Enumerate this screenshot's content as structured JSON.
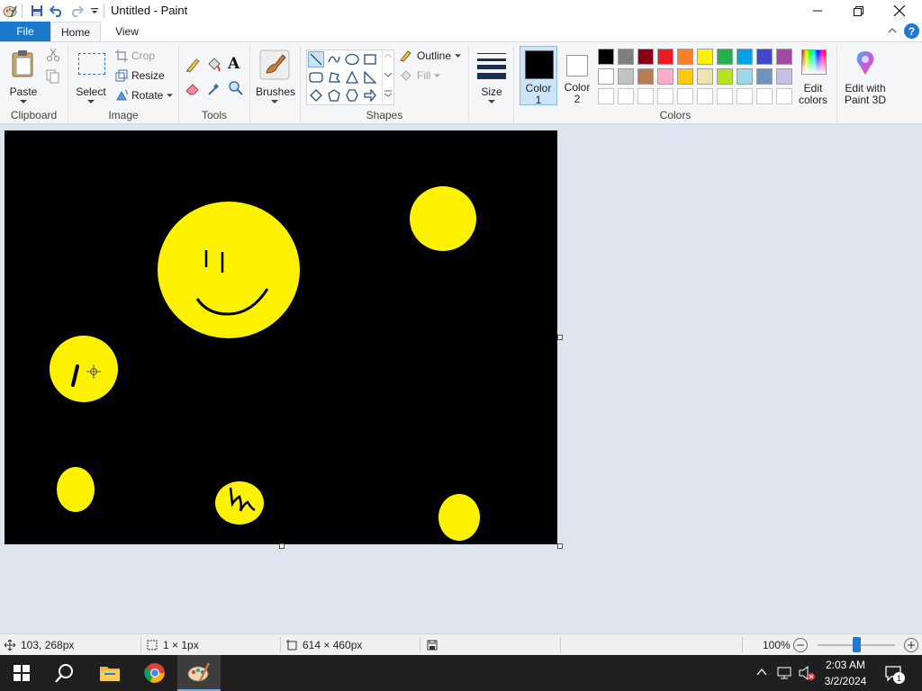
{
  "window": {
    "title": "Untitled - Paint"
  },
  "menu": {
    "file": "File",
    "home": "Home",
    "view": "View"
  },
  "clipboard": {
    "paste": "Paste",
    "group": "Clipboard"
  },
  "image": {
    "select": "Select",
    "crop": "Crop",
    "resize": "Resize",
    "rotate": "Rotate",
    "group": "Image"
  },
  "tools": {
    "group": "Tools"
  },
  "brushes": {
    "label": "Brushes"
  },
  "shapes": {
    "outline": "Outline",
    "fill": "Fill",
    "group": "Shapes"
  },
  "size": {
    "label": "Size"
  },
  "colors": {
    "color1": "Color",
    "color1_num": "1",
    "color2": "Color",
    "color2_num": "2",
    "edit": "Edit",
    "edit2": "colors",
    "paint3d": "Edit with",
    "paint3d2": "Paint 3D",
    "group": "Colors",
    "color1_value": "#000000",
    "color2_value": "#ffffff",
    "palette_row1": [
      "#000000",
      "#7f7f7f",
      "#880015",
      "#ed1c24",
      "#ff7f27",
      "#fff200",
      "#22b14c",
      "#00a2e8",
      "#3f48cc",
      "#a349a4"
    ],
    "palette_row2": [
      "#ffffff",
      "#c3c3c3",
      "#b97a57",
      "#ffaec9",
      "#ffc90e",
      "#efe4b0",
      "#b5e61d",
      "#99d9ea",
      "#7092be",
      "#c8bfe7"
    ]
  },
  "status": {
    "cursor_pos": "103, 268px",
    "selection_size": "1 × 1px",
    "image_size": "614 × 460px",
    "zoom": "100%"
  },
  "taskbar": {
    "time": "2:03 AM",
    "date": "3/2/2024",
    "notifications": "1"
  }
}
